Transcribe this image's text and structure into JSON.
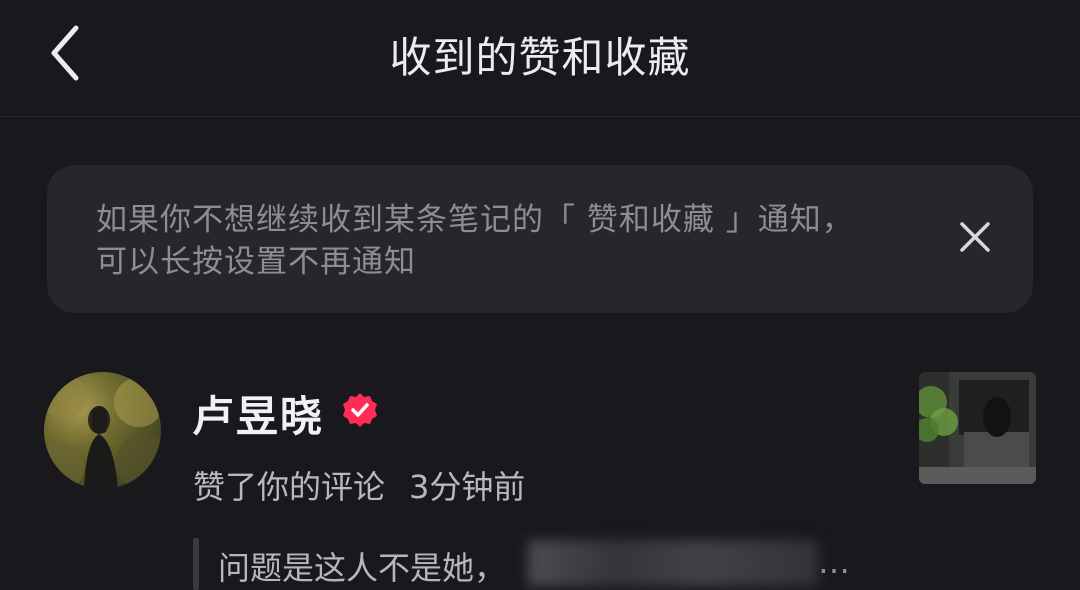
{
  "header": {
    "title": "收到的赞和收藏",
    "back_icon": "chevron-left-icon"
  },
  "notice": {
    "line1": "如果你不想继续收到某条笔记的「 赞和收藏 」通知，",
    "line2": "可以长按设置不再通知",
    "close_icon": "close-icon"
  },
  "notification": {
    "username": "卢昱晓",
    "verified_icon": "verified-check-icon",
    "action": "赞了你的评论",
    "time": "3分钟前",
    "quote": "问题是这人不是她，",
    "quote_ellipsis": "…"
  },
  "colors": {
    "background": "#19181d",
    "banner": "#27262c",
    "verified": "#ff2d55"
  }
}
